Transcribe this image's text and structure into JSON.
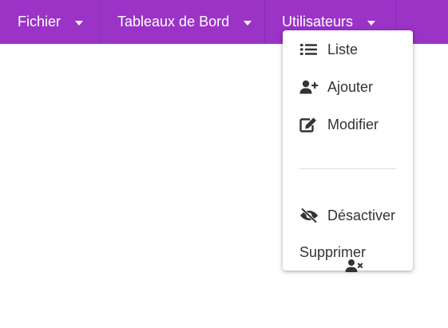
{
  "menubar": {
    "menus": [
      {
        "label": "Fichier",
        "icon": "caret-down-icon"
      },
      {
        "label": "Tableaux de Bord",
        "icon": "caret-down-icon"
      },
      {
        "label": "Utilisateurs",
        "icon": "caret-down-icon"
      }
    ],
    "background": "#9b33c7",
    "text_color": "#ffffff"
  },
  "dropdown": {
    "items": [
      {
        "label": "Liste",
        "icon": "list-icon"
      },
      {
        "label": "Ajouter",
        "icon": "user-plus-icon"
      },
      {
        "label": "Modifier",
        "icon": "edit-icon"
      },
      {
        "label": "Désactiver",
        "icon": "eye-slash-icon"
      },
      {
        "label": "Supprimer",
        "icon": "user-times-icon"
      }
    ],
    "icon_color": "#333333"
  }
}
